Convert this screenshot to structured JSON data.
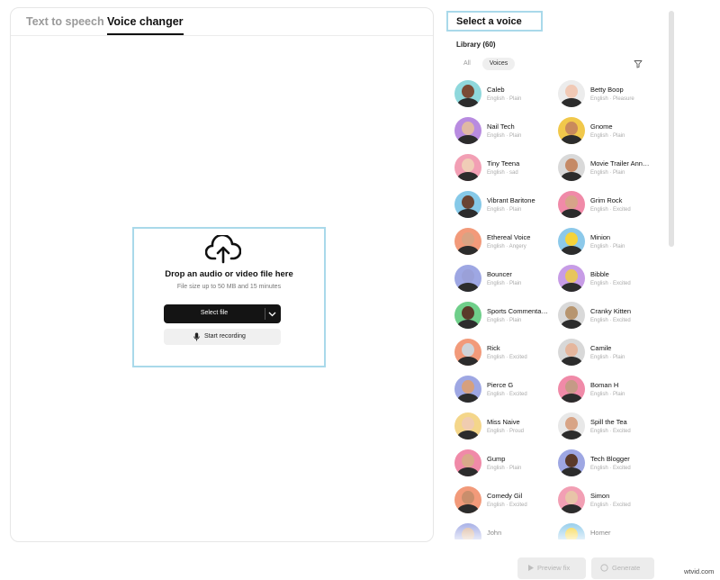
{
  "tabs": [
    {
      "label": "Text to speech",
      "active": false
    },
    {
      "label": "Voice changer",
      "active": true
    }
  ],
  "dropzone": {
    "title": "Drop an audio or video file here",
    "subtitle": "File size up to 50 MB and 15 minutes",
    "select_label": "Select file",
    "record_label": "Start recording",
    "icons": {
      "upload": "cloud-upload-icon",
      "chevron": "chevron-down-icon",
      "mic": "microphone-icon"
    }
  },
  "voice_panel": {
    "title": "Select a voice",
    "library_label": "Library (60)",
    "filters": [
      "All",
      "Voices"
    ],
    "active_filter": "Voices",
    "filter_icon": "filter-icon",
    "voices": [
      {
        "name": "Caleb",
        "meta": "English · Plain",
        "skin": "#7a4a35",
        "bg": "#8fd8dc"
      },
      {
        "name": "Betty Boop",
        "meta": "English · Pleasure",
        "skin": "#f1c9b5",
        "bg": "#ececec"
      },
      {
        "name": "Nail Tech",
        "meta": "English · Plain",
        "skin": "#e0b9a4",
        "bg": "#b88be0"
      },
      {
        "name": "Gnome",
        "meta": "English · Plain",
        "skin": "#c98a5c",
        "bg": "#f1c84b"
      },
      {
        "name": "Tiny Teena",
        "meta": "English · sad",
        "skin": "#f0cdb7",
        "bg": "#f29fb4"
      },
      {
        "name": "Movie Trailer Ann…",
        "meta": "English · Plain",
        "skin": "#c58a66",
        "bg": "#d9d9d9"
      },
      {
        "name": "Vibrant Baritone",
        "meta": "English · Plain",
        "skin": "#6a4433",
        "bg": "#86c9e8"
      },
      {
        "name": "Grim Rock",
        "meta": "English · Excited",
        "skin": "#d6a489",
        "bg": "#f08aa8"
      },
      {
        "name": "Ethereal Voice",
        "meta": "English · Angery",
        "skin": "#d9a383",
        "bg": "#f29a7a"
      },
      {
        "name": "Minion",
        "meta": "English · Plain",
        "skin": "#f5d33a",
        "bg": "#8cc9ea"
      },
      {
        "name": "Bouncer",
        "meta": "English · Plain",
        "skin": "#9aa0d8",
        "bg": "#9ea7e3"
      },
      {
        "name": "Bibble",
        "meta": "English · Excited",
        "skin": "#e7c55c",
        "bg": "#c79ce6"
      },
      {
        "name": "Sports Commenta…",
        "meta": "English · Plain",
        "skin": "#5a3a2a",
        "bg": "#6fcf8a"
      },
      {
        "name": "Cranky Kitten",
        "meta": "English · Excited",
        "skin": "#b7956f",
        "bg": "#d9d9d9"
      },
      {
        "name": "Rick",
        "meta": "English · Excited",
        "skin": "#cfd3d8",
        "bg": "#f29a7a"
      },
      {
        "name": "Camile",
        "meta": "English · Plain",
        "skin": "#e5b69d",
        "bg": "#d8d8d8"
      },
      {
        "name": "Pierce G",
        "meta": "English · Excited",
        "skin": "#d6a07d",
        "bg": "#9ea7e3"
      },
      {
        "name": "Boman H",
        "meta": "English · Plain",
        "skin": "#c59a86",
        "bg": "#f08aa8"
      },
      {
        "name": "Miss Naive",
        "meta": "English · Proud",
        "skin": "#f0ccb0",
        "bg": "#f4d68a"
      },
      {
        "name": "Spill the Tea",
        "meta": "English · Excited",
        "skin": "#d8a486",
        "bg": "#e8e8e8"
      },
      {
        "name": "Gump",
        "meta": "English · Plain",
        "skin": "#d9a98a",
        "bg": "#f08aa8"
      },
      {
        "name": "Tech Blogger",
        "meta": "English · Excited",
        "skin": "#5a3a2a",
        "bg": "#9ea7e3"
      },
      {
        "name": "Comedy Gil",
        "meta": "English · Excited",
        "skin": "#c98e6c",
        "bg": "#f29a7a"
      },
      {
        "name": "Simon",
        "meta": "English · Excited",
        "skin": "#e8c4a8",
        "bg": "#f29fb4"
      },
      {
        "name": "John",
        "meta": "",
        "skin": "#d9b49a",
        "bg": "#9ea7e3"
      },
      {
        "name": "Homer",
        "meta": "",
        "skin": "#f5d33a",
        "bg": "#8cc9ea"
      }
    ]
  },
  "actions": {
    "preview_label": "Preview fix",
    "generate_label": "Generate"
  },
  "watermark": "wtvid.com"
}
